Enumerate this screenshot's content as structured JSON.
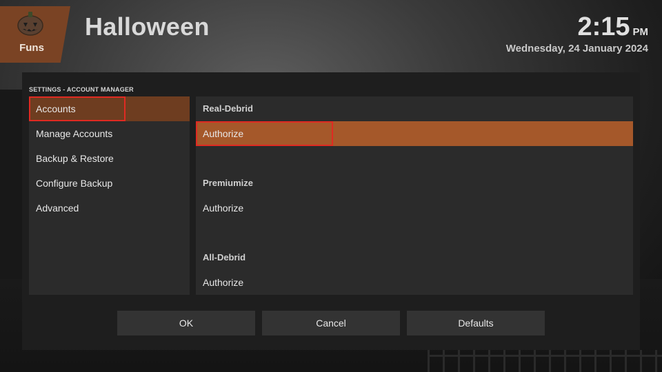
{
  "header": {
    "logo_label": "Funs",
    "title": "Halloween",
    "time": "2:15",
    "ampm": "PM",
    "date": "Wednesday, 24 January 2024"
  },
  "dialog": {
    "title": "SETTINGS - ACCOUNT MANAGER",
    "categories": [
      {
        "label": "Accounts",
        "selected": true
      },
      {
        "label": "Manage Accounts"
      },
      {
        "label": "Backup & Restore"
      },
      {
        "label": "Configure Backup"
      },
      {
        "label": "Advanced"
      }
    ],
    "settings": [
      {
        "type": "header",
        "label": "Real-Debrid"
      },
      {
        "type": "action",
        "label": "Authorize",
        "focused": true
      },
      {
        "type": "header",
        "label": "Premiumize"
      },
      {
        "type": "action",
        "label": "Authorize"
      },
      {
        "type": "header",
        "label": "All-Debrid"
      },
      {
        "type": "action",
        "label": "Authorize"
      }
    ],
    "buttons": {
      "ok": "OK",
      "cancel": "Cancel",
      "defaults": "Defaults"
    }
  },
  "colors": {
    "accent": "#a5582a",
    "selected_category": "#6e3d20",
    "highlight_outline": "#e02a22",
    "logo_tile": "#7a4324"
  },
  "icons": {
    "logo": "pumpkin-icon"
  }
}
